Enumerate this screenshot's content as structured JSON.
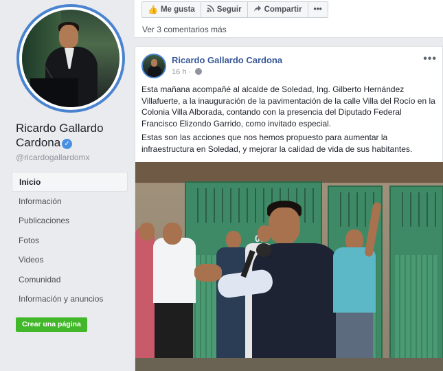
{
  "sidebar": {
    "page_name": "Ricardo Gallardo Cardona",
    "handle": "@ricardogallardomx",
    "nav": [
      {
        "label": "Inicio",
        "active": true
      },
      {
        "label": "Información"
      },
      {
        "label": "Publicaciones"
      },
      {
        "label": "Fotos"
      },
      {
        "label": "Videos"
      },
      {
        "label": "Comunidad"
      },
      {
        "label": "Información y anuncios"
      }
    ],
    "create_page": "Crear una página"
  },
  "prev_post": {
    "like": "Me gusta",
    "follow": "Seguir",
    "share": "Compartir",
    "more": "•••",
    "comments_link": "Ver 3 comentarios más"
  },
  "post": {
    "author": "Ricardo Gallardo Cardona",
    "time": "16 h",
    "menu": "•••",
    "paragraphs": [
      "Esta mañana acompañé al alcalde de Soledad, Ing. Gilberto Hernández Villafuerte, a la inauguración de la pavimentación de la calle Villa del Rocío en la Colonia Villa Alborada, contando con la presencia del Diputado Federal Francisco Elizondo Garrido, como invitado especial.",
      "Estas son las acciones que nos hemos propuesto para aumentar la infraestructura en Soledad, y mejorar la calidad de vida de sus habitantes."
    ],
    "image_text": "09"
  },
  "colors": {
    "link_blue": "#385898",
    "verified_blue": "#4a90e2",
    "create_green": "#42b72a",
    "door_green": "#3f8a66"
  },
  "icons": {
    "like": "thumbs-up-icon",
    "follow": "rss-icon",
    "share": "share-arrow-icon",
    "verified": "verified-check-icon",
    "privacy": "globe-icon"
  }
}
